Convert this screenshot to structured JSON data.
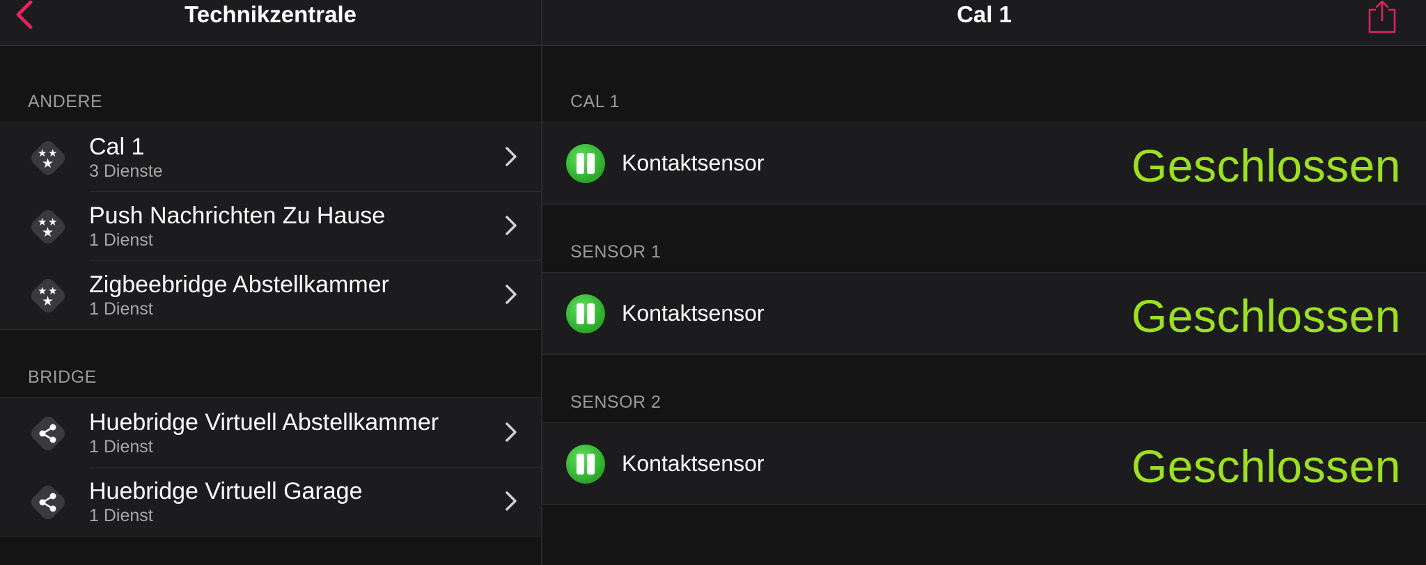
{
  "left": {
    "nav_title": "Technikzentrale",
    "sections": [
      {
        "header": "ANDERE",
        "items": [
          {
            "title": "Cal 1",
            "subtitle": "3 Dienste",
            "icon": "stars-icon"
          },
          {
            "title": "Push Nachrichten Zu Hause",
            "subtitle": "1 Dienst",
            "icon": "stars-icon"
          },
          {
            "title": "Zigbeebridge Abstellkammer",
            "subtitle": "1 Dienst",
            "icon": "stars-icon"
          }
        ]
      },
      {
        "header": "BRIDGE",
        "items": [
          {
            "title": "Huebridge Virtuell Abstellkammer",
            "subtitle": "1 Dienst",
            "icon": "share-icon"
          },
          {
            "title": "Huebridge Virtuell Garage",
            "subtitle": "1 Dienst",
            "icon": "share-icon"
          }
        ]
      }
    ]
  },
  "right": {
    "nav_title": "Cal 1",
    "sections": [
      {
        "header": "CAL 1",
        "label": "Kontaktsensor",
        "state": "Geschlossen"
      },
      {
        "header": "SENSOR 1",
        "label": "Kontaktsensor",
        "state": "Geschlossen"
      },
      {
        "header": "SENSOR 2",
        "label": "Kontaktsensor",
        "state": "Geschlossen"
      }
    ]
  },
  "colors": {
    "accent": "#e0245e",
    "state": "#9de021",
    "sensor_icon": "#2aa82a"
  }
}
